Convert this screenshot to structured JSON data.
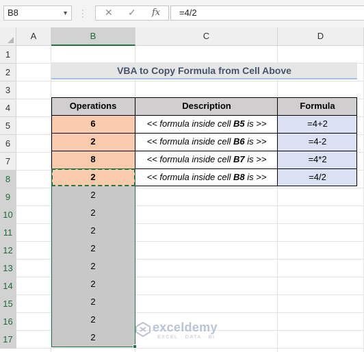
{
  "formula_bar": {
    "name_box": "B8",
    "cancel_icon": "✕",
    "enter_icon": "✓",
    "fx_icon": "fx",
    "formula": "=4/2"
  },
  "columns": [
    "A",
    "B",
    "C",
    "D"
  ],
  "selected_column": "B",
  "rows": [
    "1",
    "2",
    "3",
    "4",
    "5",
    "6",
    "7",
    "8",
    "9",
    "10",
    "11",
    "12",
    "13",
    "14",
    "15",
    "16",
    "17"
  ],
  "title": "VBA to Copy Formula from Cell Above",
  "table": {
    "headers": [
      "Operations",
      "Description",
      "Formula"
    ],
    "rows": [
      {
        "op": "6",
        "desc_pre": "<< formula inside cell ",
        "cell": "B5",
        "desc_post": " is >>",
        "formula": "=4+2"
      },
      {
        "op": "2",
        "desc_pre": "<< formula inside cell ",
        "cell": "B6",
        "desc_post": " is >>",
        "formula": "=4-2"
      },
      {
        "op": "8",
        "desc_pre": "<< formula inside cell ",
        "cell": "B7",
        "desc_post": " is >>",
        "formula": "=4*2"
      },
      {
        "op": "2",
        "desc_pre": "<< formula inside cell ",
        "cell": "B8",
        "desc_post": " is >>",
        "formula": "=4/2"
      }
    ]
  },
  "filled_values": [
    "2",
    "2",
    "2",
    "2",
    "2",
    "2",
    "2",
    "2",
    "2"
  ],
  "watermark": {
    "name": "exceldemy",
    "tagline": "EXCEL · DATA · BI"
  },
  "colors": {
    "header_fill": "#d0cece",
    "operations_fill": "#f8cbad",
    "formula_fill": "#d9e1f2",
    "selection_green": "#217346",
    "selected_fill": "#c8c8c8"
  }
}
